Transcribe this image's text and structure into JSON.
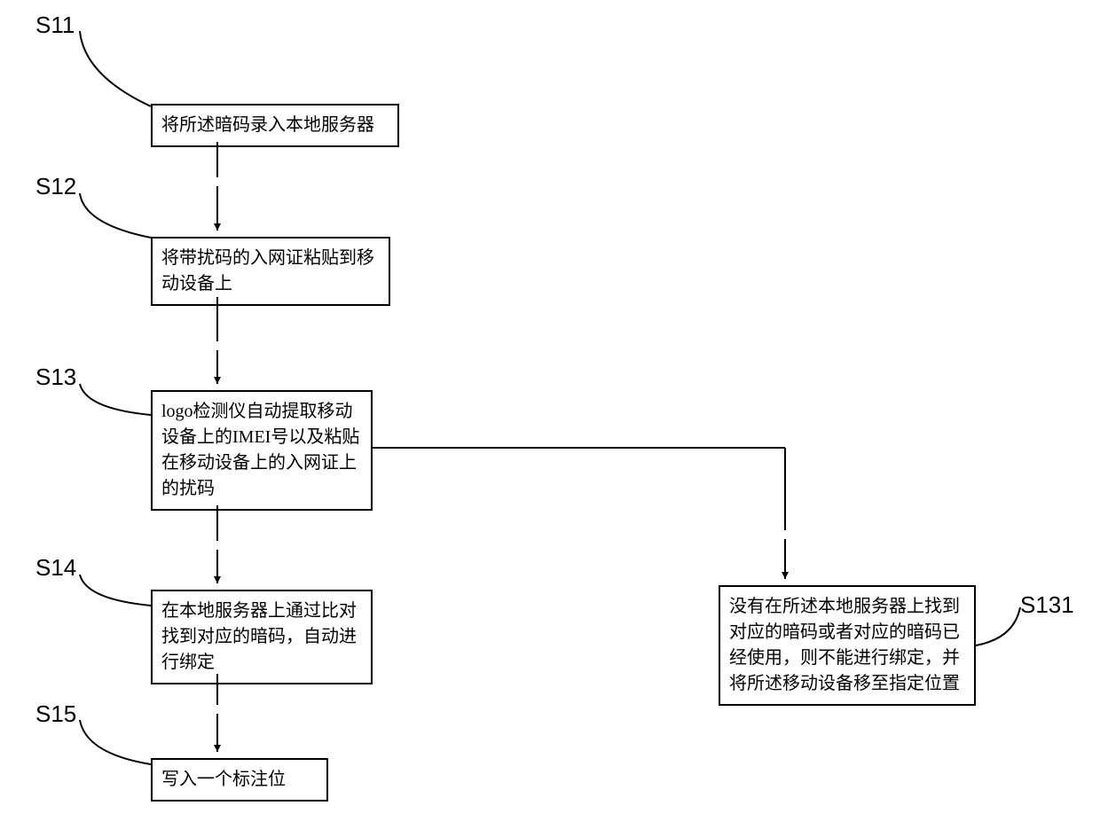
{
  "labels": {
    "s11": "S11",
    "s12": "S12",
    "s13": "S13",
    "s14": "S14",
    "s15": "S15",
    "s131": "S131"
  },
  "boxes": {
    "b11": "将所述暗码录入本地服务器",
    "b12": "将带扰码的入网证粘贴到移动设备上",
    "b13": "logo检测仪自动提取移动设备上的IMEI号以及粘贴在移动设备上的入网证上的扰码",
    "b14": "在本地服务器上通过比对找到对应的暗码，自动进行绑定",
    "b15": "写入一个标注位",
    "b131": "没有在所述本地服务器上找到对应的暗码或者对应的暗码已经使用，则不能进行绑定，并将所述移动设备移至指定位置"
  }
}
